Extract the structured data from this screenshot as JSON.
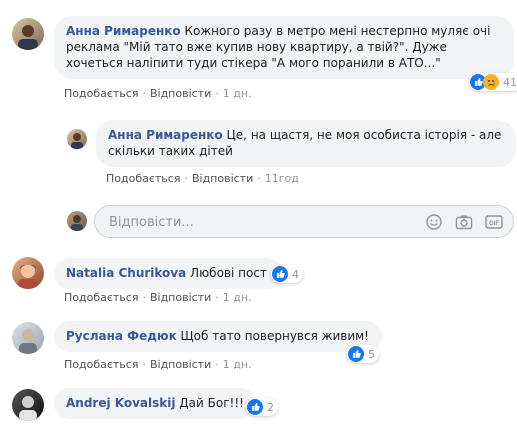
{
  "comments": [
    {
      "author": "Анна Римаренко",
      "text": " Кожного разу в метро мені нестерпно муляє очі реклама \"Мій тато вже купив нову квартиру, а твій?\". Дуже хочеться наліпити туди стікера \"А мого поранили в АТО...\"",
      "like": "Подобається",
      "reply": "Відповісти",
      "time": "1 дн.",
      "reactions": "41"
    },
    {
      "author": "Natalia Churikova",
      "text": " Любові пост",
      "like": "Подобається",
      "reply": "Відповісти",
      "time": "1 дн.",
      "reactions": "4"
    },
    {
      "author": "Руслана Федюк",
      "text": " Щоб тато повернувся живим!",
      "like": "Подобається",
      "reply": "Відповісти",
      "time": "1 дн.",
      "reactions": "5"
    },
    {
      "author": "Andrej Kovalskij",
      "text": " Дай Бог!!!",
      "reactions": "2"
    }
  ],
  "reply": {
    "author": "Анна Римаренко",
    "text": " Це, на щастя, не моя особиста історія - але скільки таких дітей",
    "like": "Подобається",
    "reply": "Відповісти",
    "time": "11год"
  },
  "reply_input": {
    "placeholder": "Відповісти...",
    "icons": [
      "smiley-icon",
      "camera-icon",
      "gif-icon",
      "sticker-icon"
    ]
  },
  "colors": {
    "link": "#385898",
    "bubble": "#f2f3f5",
    "like_blue": "#1877f2",
    "muted": "#90949c"
  }
}
